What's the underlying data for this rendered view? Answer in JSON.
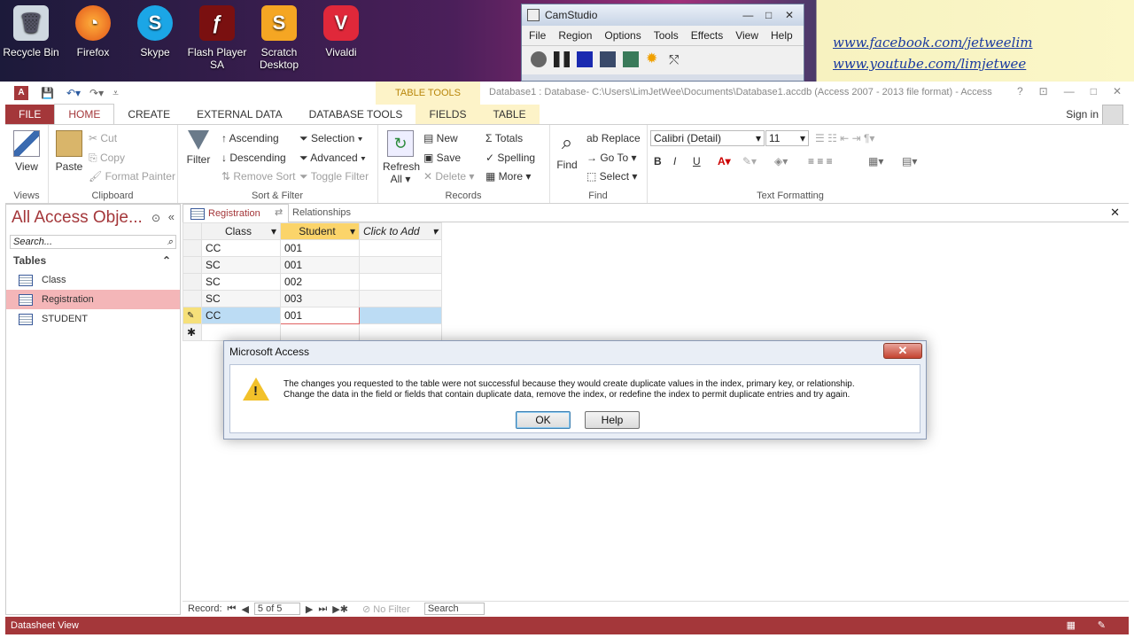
{
  "desktop": {
    "icons": [
      {
        "label": "Recycle Bin",
        "icon": "recycle-bin-icon"
      },
      {
        "label": "Firefox",
        "icon": "firefox-icon"
      },
      {
        "label": "Skype",
        "icon": "skype-icon"
      },
      {
        "label": "Flash Player SA",
        "icon": "flash-icon"
      },
      {
        "label": "Scratch Desktop",
        "icon": "scratch-icon"
      },
      {
        "label": "Vivaldi",
        "icon": "vivaldi-icon"
      }
    ],
    "social": [
      "www.facebook.com/jetweelim",
      "www.youtube.com/limjetwee"
    ]
  },
  "camstudio": {
    "title": "CamStudio",
    "menu": [
      "File",
      "Region",
      "Options",
      "Tools",
      "Effects",
      "View",
      "Help"
    ]
  },
  "access": {
    "table_tools": "TABLE TOOLS",
    "caption": "Database1 : Database- C:\\Users\\LimJetWee\\Documents\\Database1.accdb (Access 2007 - 2013 file format) - Access",
    "tabs": [
      "FILE",
      "HOME",
      "CREATE",
      "EXTERNAL DATA",
      "DATABASE TOOLS",
      "FIELDS",
      "TABLE"
    ],
    "signin": "Sign in",
    "ribbon": {
      "views": {
        "view": "View",
        "label": "Views"
      },
      "clipboard": {
        "paste": "Paste",
        "cut": "Cut",
        "copy": "Copy",
        "format_painter": "Format Painter",
        "label": "Clipboard"
      },
      "sort": {
        "filter": "Filter",
        "ascending": "Ascending",
        "descending": "Descending",
        "remove_sort": "Remove Sort",
        "selection": "Selection",
        "advanced": "Advanced",
        "toggle": "Toggle Filter",
        "label": "Sort & Filter"
      },
      "records": {
        "refresh": "Refresh",
        "all": "All",
        "new": "New",
        "save": "Save",
        "delete": "Delete",
        "totals": "Totals",
        "spelling": "Spelling",
        "more": "More",
        "label": "Records"
      },
      "find": {
        "find": "Find",
        "replace": "Replace",
        "goto": "Go To",
        "select": "Select",
        "label": "Find"
      },
      "text": {
        "font": "Calibri (Detail)",
        "size": "11",
        "label": "Text Formatting"
      }
    }
  },
  "nav": {
    "title": "All Access Obje...",
    "search_placeholder": "Search...",
    "section": "Tables",
    "items": [
      "Class",
      "Registration",
      "STUDENT"
    ]
  },
  "doc": {
    "tabs": [
      "Registration",
      "Relationships"
    ],
    "columns": [
      "Class",
      "Student",
      "Click to Add"
    ],
    "rows": [
      [
        "CC",
        "001"
      ],
      [
        "SC",
        "001"
      ],
      [
        "SC",
        "002"
      ],
      [
        "SC",
        "003"
      ],
      [
        "CC",
        "001"
      ]
    ]
  },
  "dialog": {
    "title": "Microsoft Access",
    "line1": "The changes you requested to the table were not successful because they would create duplicate values in the index, primary key, or relationship.",
    "line2": "Change the data in the field or fields that contain duplicate data, remove the index, or redefine the index to permit duplicate entries and try again.",
    "ok": "OK",
    "help": "Help"
  },
  "recnav": {
    "label": "Record:",
    "position": "5 of 5",
    "filter": "No Filter",
    "search": "Search"
  },
  "status": "Datasheet View"
}
